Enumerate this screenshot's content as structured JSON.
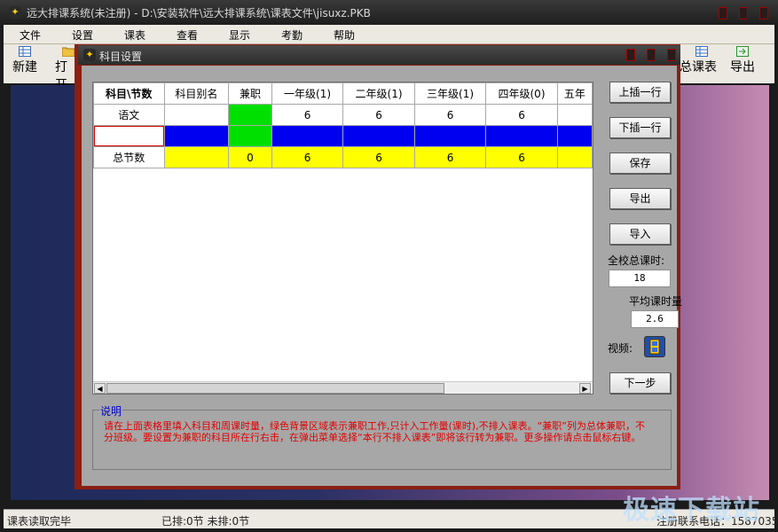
{
  "window": {
    "title": "远大排课系统(未注册) - D:\\安装软件\\远大排课系统\\课表文件\\jisuxz.PKB"
  },
  "menu": [
    "文件",
    "设置",
    "课表",
    "查看",
    "显示",
    "考勤",
    "帮助"
  ],
  "toolbar": {
    "new": "新建",
    "open": "打开",
    "total": "总课表",
    "export": "导出"
  },
  "dialog": {
    "title": "科目设置",
    "table": {
      "headers": [
        "科目\\节数",
        "科目别名",
        "兼职",
        "一年级(1)",
        "二年级(1)",
        "三年级(1)",
        "四年级(0)",
        "五年"
      ],
      "rows": [
        [
          "语文",
          "",
          "",
          "6",
          "6",
          "6",
          "6",
          ""
        ],
        [
          "",
          "",
          "",
          "",
          "",
          "",
          "",
          ""
        ],
        [
          "总节数",
          "",
          "0",
          "6",
          "6",
          "6",
          "6",
          ""
        ]
      ]
    },
    "buttons": {
      "insert_above": "上插一行",
      "insert_below": "下插一行",
      "save": "保存",
      "export": "导出",
      "import": "导入",
      "next": "下一步"
    },
    "total_label": "全校总课时:",
    "total_value": "18",
    "avg_label": "平均课时量",
    "avg_value": "2.6",
    "video_label": "视频:",
    "note_title": "说明",
    "note_text": "请在上面表格里填入科目和周课时量，绿色背景区域表示兼职工作,只计入工作量(课时),不排入课表。“兼职”列为总体兼职，不分班级。要设置为兼职的科目所在行右击，在弹出菜单选择“本行不排入课表”即将该行转为兼职。更多操作请点击鼠标右键。"
  },
  "status": {
    "left": "课表读取完毕",
    "middle": "已排:0节 未排:0节",
    "right": "注册联系电话：1587035"
  },
  "watermark": "极速下载站",
  "colors": {
    "dialog_border": "#8b1f12",
    "parttime_cell": "#00e000",
    "selected_row": "#0000f0",
    "total_row": "#ffff00",
    "note_text": "#e00000"
  }
}
